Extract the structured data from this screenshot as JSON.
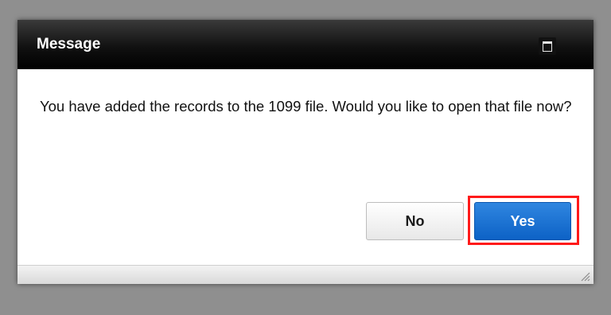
{
  "dialog": {
    "title": "Message",
    "message": "You have added the records to the 1099 file. Would you like to open that file now?",
    "buttons": {
      "no_label": "No",
      "yes_label": "Yes"
    },
    "icons": {
      "maximize": "maximize-icon",
      "resize": "resize-grip-icon"
    },
    "colors": {
      "primary_button": "#1672d6",
      "highlight_border": "#ff1a1a",
      "titlebar": "#000000"
    }
  }
}
